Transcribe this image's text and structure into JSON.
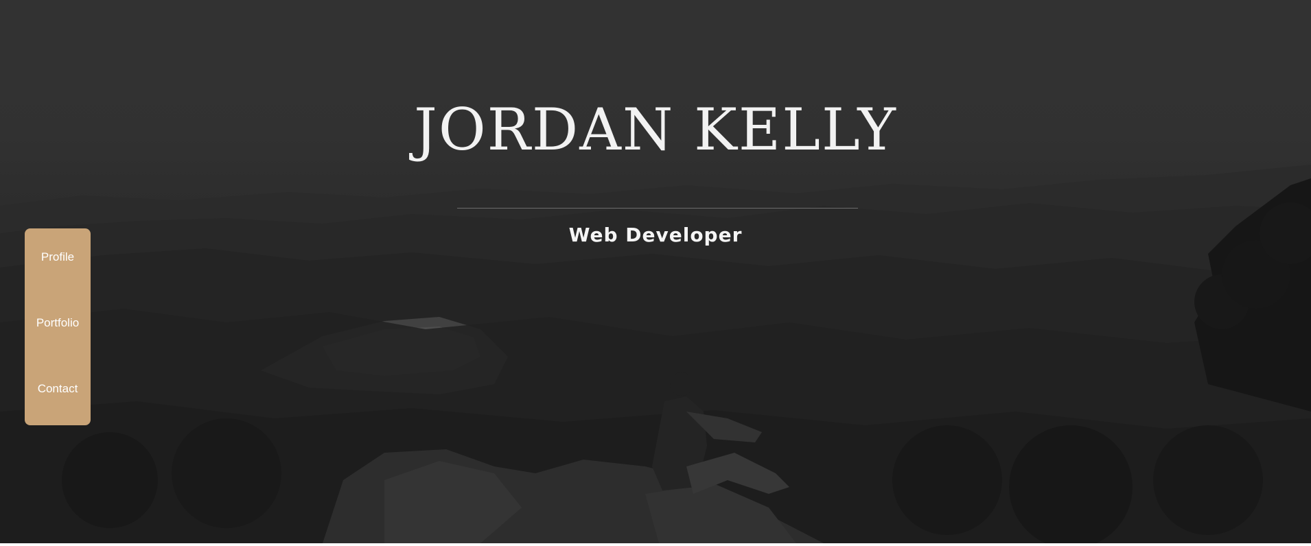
{
  "hero": {
    "title": "JORDAN KELLY",
    "subtitle": "Web Developer"
  },
  "nav": {
    "items": [
      {
        "label": "Profile"
      },
      {
        "label": "Portfolio"
      },
      {
        "label": "Contact"
      }
    ]
  },
  "colors": {
    "nav_background": "#c9a478",
    "overlay": "#333333",
    "text": "#f2f2f2"
  }
}
